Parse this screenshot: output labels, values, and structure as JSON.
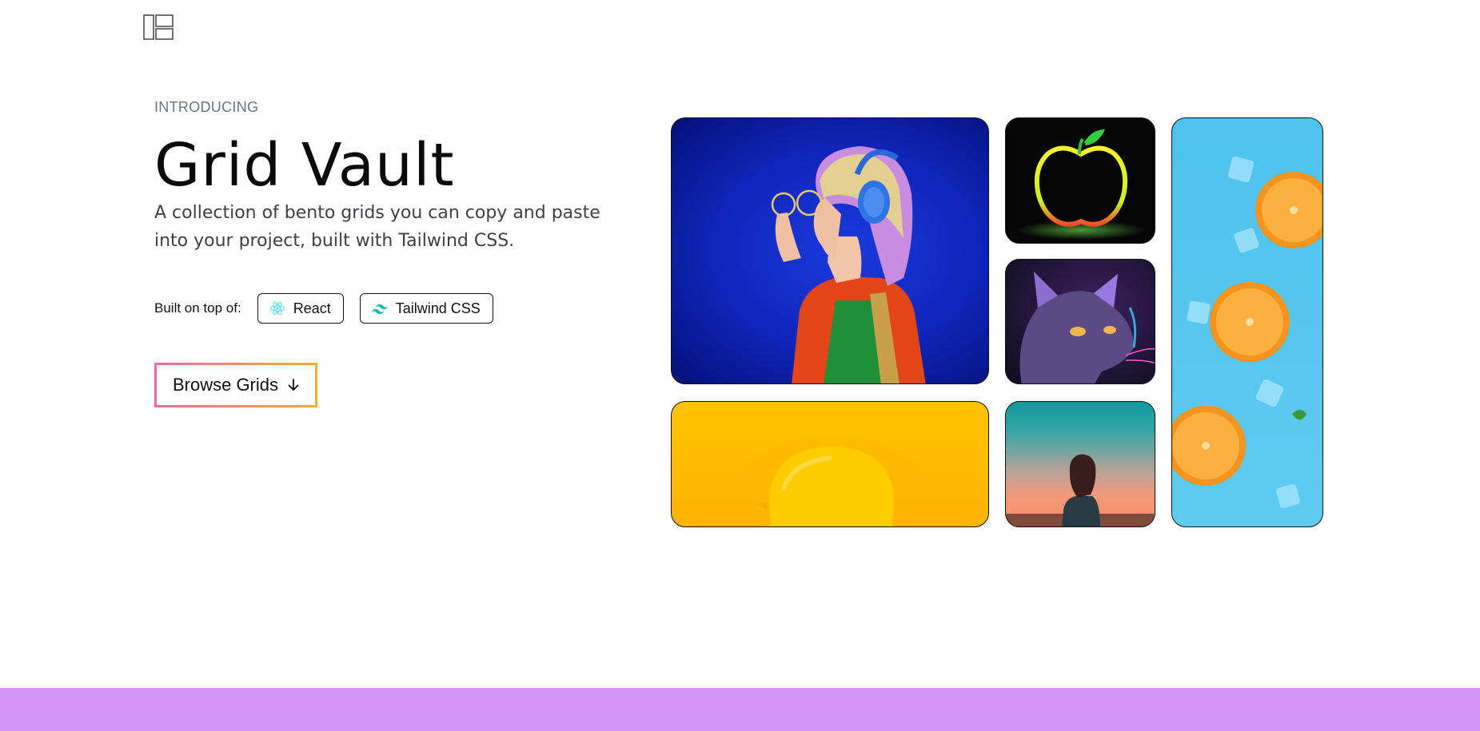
{
  "header": {
    "logo_icon": "bento-grid-logo-icon"
  },
  "hero": {
    "eyebrow": "INTRODUCING",
    "title": "Grid Vault",
    "subtitle": "A collection of bento grids you can copy and paste into your project, built with Tailwind CSS."
  },
  "built_on": {
    "label": "Built on top of:",
    "chips": [
      {
        "label": "React",
        "icon": "react-icon",
        "color": "#61dafb"
      },
      {
        "label": "Tailwind CSS",
        "icon": "tailwind-icon",
        "color": "#38bdf8"
      }
    ]
  },
  "cta": {
    "label": "Browse Grids",
    "icon": "arrow-down-icon",
    "gradient": [
      "#ec6aa0",
      "#f3b132"
    ]
  },
  "gallery": {
    "images": [
      {
        "name": "woman-headphones-image",
        "icon": "photo"
      },
      {
        "name": "neon-apple-image",
        "icon": "photo"
      },
      {
        "name": "neon-cat-image",
        "icon": "photo"
      },
      {
        "name": "oranges-ice-image",
        "icon": "photo"
      },
      {
        "name": "lemon-image",
        "icon": "photo"
      },
      {
        "name": "woman-sunset-image",
        "icon": "photo"
      }
    ]
  },
  "colors": {
    "footer_band": "#d693f7",
    "text": "#111111",
    "muted": "#6b7280"
  }
}
